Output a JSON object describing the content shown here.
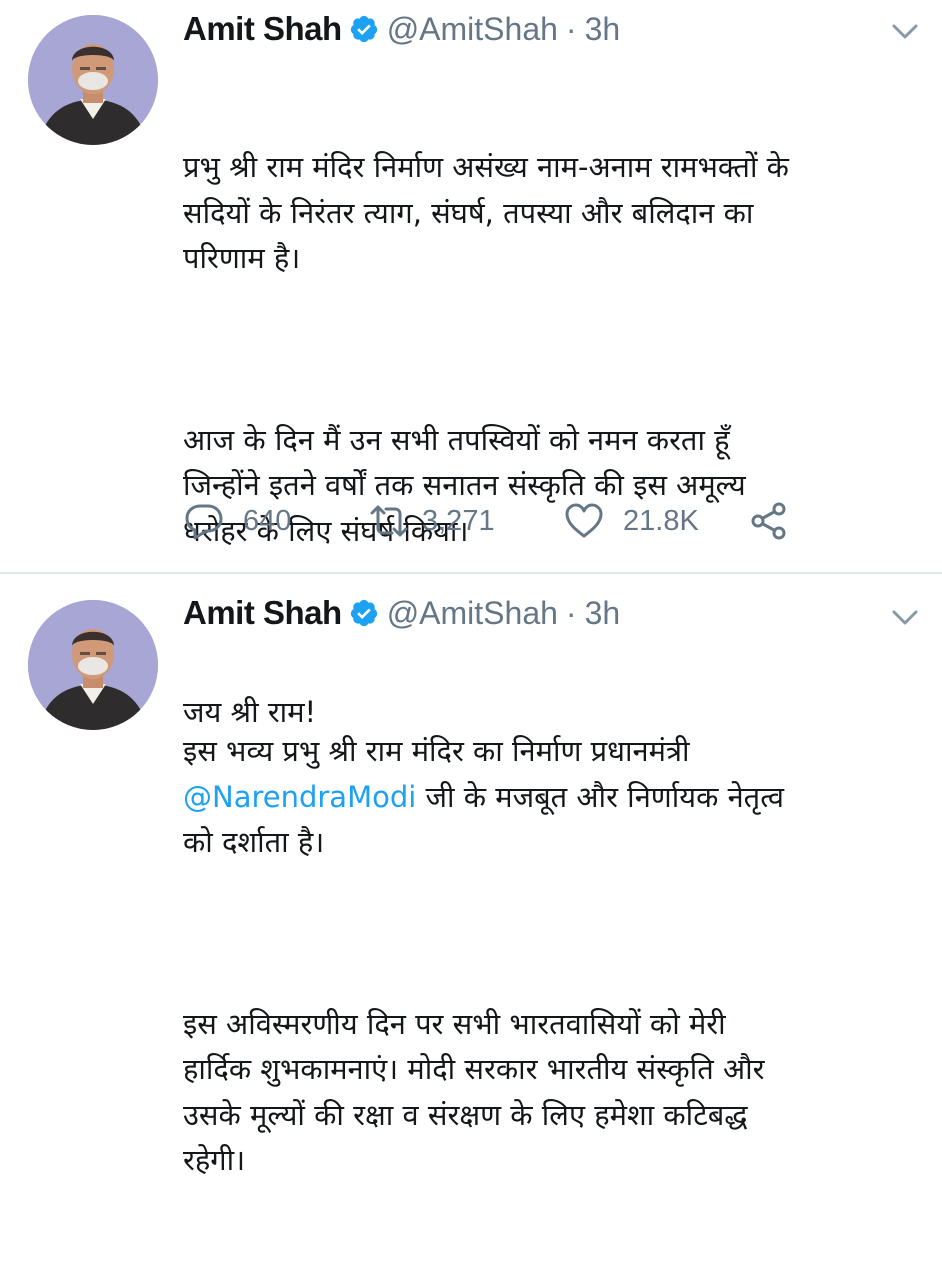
{
  "tweets": [
    {
      "author_name": "Amit Shah",
      "handle": "@AmitShah",
      "separator": "·",
      "time": "3h",
      "paragraphs": [
        "प्रभु श्री राम मंदिर निर्माण असंख्य नाम-अनाम रामभक्तों के\nसदियों के निरंतर त्याग, संघर्ष, तपस्या और बलिदान का\nपरिणाम है।",
        "आज के दिन मैं उन सभी तपस्वियों को नमन करता हूँ\nजिन्होंने इतने वर्षों तक सनातन संस्कृति की इस अमूल्य\nधरोहर के लिए संघर्ष किया।",
        "जय श्री राम!"
      ],
      "replies": "640",
      "retweets": "3,271",
      "likes": "21.8K"
    },
    {
      "author_name": "Amit Shah",
      "handle": "@AmitShah",
      "separator": "·",
      "time": "3h",
      "p1_line1": "इस भव्य प्रभु श्री राम मंदिर का निर्माण प्रधानमंत्री",
      "mention": "@NarendraModi",
      "p1_rest": " जी के मजबूत और निर्णायक नेतृत्व\nको दर्शाता है।",
      "p2": "इस अविस्मरणीय दिन पर सभी भारतवासियों को मेरी\nहार्दिक शुभकामनाएं। मोदी सरकार भारतीय संस्कृति और\nउसके मूल्यों की रक्षा व संरक्षण के लिए हमेशा कटिबद्ध\nरहेगी।"
    }
  ],
  "icons": {
    "verified": "verified-badge-icon",
    "caret": "chevron-down-icon",
    "reply": "reply-icon",
    "retweet": "retweet-icon",
    "like": "heart-icon",
    "share": "share-icon"
  },
  "colors": {
    "verified_badge": "#1da1f2",
    "secondary_text": "#657786",
    "link": "#1da1f2",
    "divider": "#e1e8ed"
  }
}
